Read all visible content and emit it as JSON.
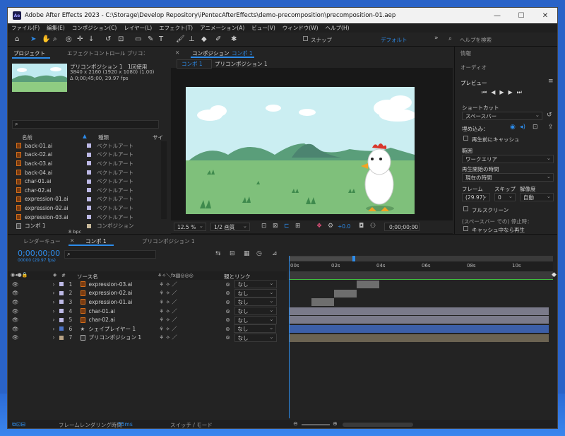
{
  "window": {
    "title": "Adobe After Effects 2023 - C:\\Storage\\Develop Repository\\iPentecAfterEffects\\demo-precomposition\\precomposition-01.aep",
    "logo": "Ae",
    "min": "—",
    "max": "☐",
    "close": "✕"
  },
  "menu": [
    "ファイル(F)",
    "編集(E)",
    "コンポジション(C)",
    "レイヤー(L)",
    "エフェクト(T)",
    "アニメーション(A)",
    "ビュー(V)",
    "ウィンドウ(W)",
    "ヘルプ(H)"
  ],
  "toolbar": {
    "snap_label": "スナップ",
    "workspace": "デフォルト",
    "search_placeholder": "ヘルプを検索"
  },
  "project": {
    "tab": "プロジェクト",
    "tab2": "エフェクトコントロール プリコン",
    "selected_name": "プリコンポジション 1",
    "usage": "1回使用",
    "dims": "3840 x 2160 (1920 x 1080) (1.00)",
    "duration": "Δ 0;00;45;00, 29.97 fps",
    "col_name": "名前",
    "col_type": "種類",
    "col_size": "サイ",
    "bpc": "8 bpc",
    "items": [
      {
        "name": "back-01.ai",
        "type": "ベクトルアート",
        "kind": "file"
      },
      {
        "name": "back-02.ai",
        "type": "ベクトルアート",
        "kind": "file"
      },
      {
        "name": "back-03.ai",
        "type": "ベクトルアート",
        "kind": "file"
      },
      {
        "name": "back-04.ai",
        "type": "ベクトルアート",
        "kind": "file"
      },
      {
        "name": "char-01.ai",
        "type": "ベクトルアート",
        "kind": "file"
      },
      {
        "name": "char-02.ai",
        "type": "ベクトルアート",
        "kind": "file"
      },
      {
        "name": "expression-01.ai",
        "type": "ベクトルアート",
        "kind": "file"
      },
      {
        "name": "expression-02.ai",
        "type": "ベクトルアート",
        "kind": "file"
      },
      {
        "name": "expression-03.ai",
        "type": "ベクトルアート",
        "kind": "file"
      },
      {
        "name": "コンポ 1",
        "type": "コンポジション",
        "kind": "comp"
      }
    ]
  },
  "viewer": {
    "tab": "コンポジション",
    "tab_comp": "コンポ 1",
    "crumb1": "コンポ 1",
    "crumb2": "プリコンポジション 1",
    "zoom": "12.5 %",
    "quality": "1/2 画質",
    "exposure": "+0.0",
    "timecode": "0;00;00;00"
  },
  "right": {
    "info": "情報",
    "audio": "オーディオ",
    "preview": "プレビュー",
    "shortcut_label": "ショートカット",
    "shortcut": "スペースバー",
    "include_label": "埋め込み：",
    "cache_label": "再生前にキャッシュ",
    "range_label": "範囲",
    "range": "ワークエリア",
    "start_label": "再生開始の時間",
    "start": "現在の時間",
    "frame_label": "フレーム",
    "skip_label": "スキップ",
    "res_label": "解像度",
    "frame": "(29.97)",
    "skip": "0",
    "res": "自動",
    "fullscreen": "フルスクリーン",
    "stop_label": "(スペースバー での) 停止時：",
    "cache_stop": "キャッシュ中なら再生"
  },
  "timeline": {
    "tab_render": "レンダーキュー",
    "tab_comp": "コンポ 1",
    "tab_precomp": "プリコンポジション 1",
    "timecode": "0;00;00;00",
    "fps": "00000 (29.97 fps)",
    "col_num": "#",
    "col_source": "ソース名",
    "col_parent": "親とリンク",
    "parent_none": "なし",
    "ticks": [
      "00s",
      "02s",
      "04s",
      "06s",
      "08s",
      "10s"
    ],
    "layers": [
      {
        "num": "1",
        "name": "expression-03.ai",
        "swatch": "#bdb9e6",
        "bar": "#6e6e6e"
      },
      {
        "num": "2",
        "name": "expression-02.ai",
        "swatch": "#bdb9e6",
        "bar": "#6e6e6e"
      },
      {
        "num": "3",
        "name": "expression-01.ai",
        "swatch": "#bdb9e6",
        "bar": "#6e6e6e"
      },
      {
        "num": "4",
        "name": "char-01.ai",
        "swatch": "#bdb9e6",
        "bar": "#7a7a8a"
      },
      {
        "num": "5",
        "name": "char-02.ai",
        "swatch": "#bdb9e6",
        "bar": "#7a7a8a"
      },
      {
        "num": "6",
        "name": "シェイプレイヤー 1",
        "swatch": "#4d74c8",
        "bar": "#3c5fa8"
      },
      {
        "num": "7",
        "name": "プリコンポジション 1",
        "swatch": "#b8a285",
        "bar": "#6b6352"
      }
    ]
  },
  "status": {
    "render_label": "フレームレンダリング時間",
    "render_time": "55ms",
    "switch_label": "スイッチ / モード"
  },
  "colors": {
    "accent": "#2d8ceb",
    "bg": "#232323"
  }
}
